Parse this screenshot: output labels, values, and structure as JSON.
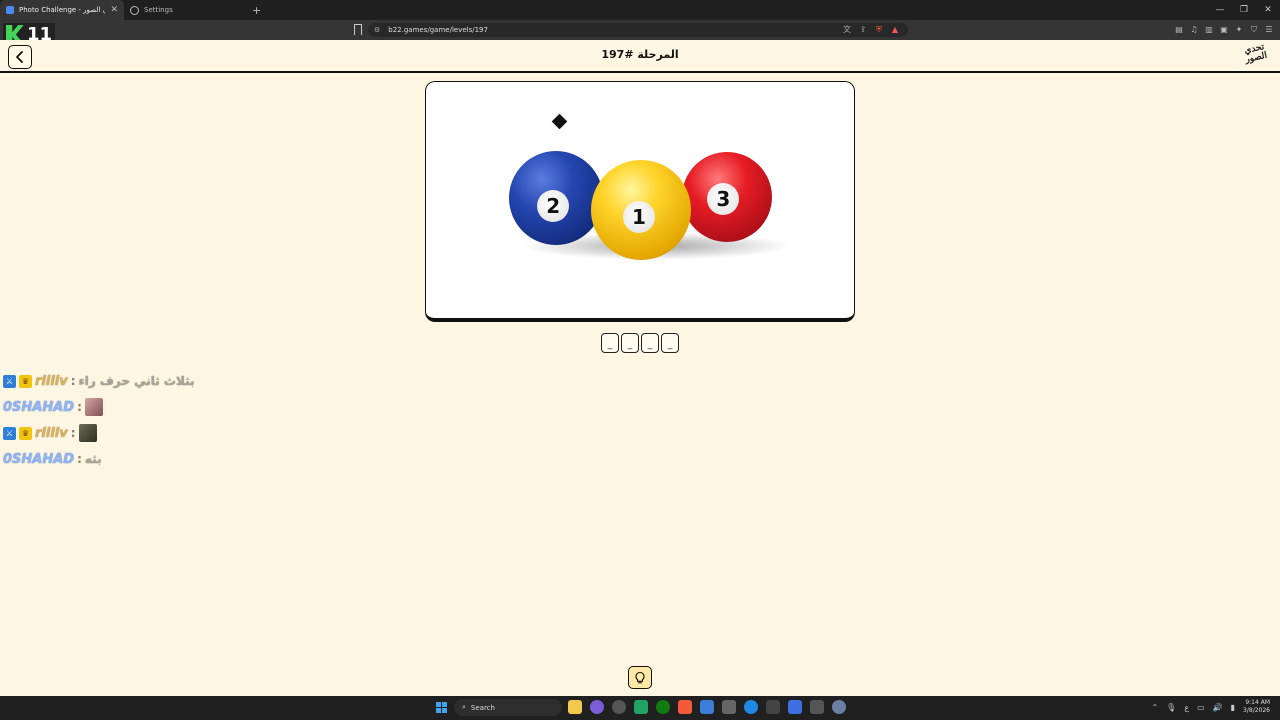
{
  "browser": {
    "tabs": [
      {
        "title": "Photo Challenge - تحدي الصور",
        "active": true
      },
      {
        "title": "Settings",
        "active": false
      }
    ],
    "url": "b22.games/game/levels/197"
  },
  "overlay": {
    "counter": "11"
  },
  "header": {
    "level_title": "المرحلة #197",
    "logo_text": "تحدي الصور"
  },
  "puzzle": {
    "balls": [
      {
        "number": "2",
        "color": "blue"
      },
      {
        "number": "1",
        "color": "yellow"
      },
      {
        "number": "3",
        "color": "red"
      }
    ],
    "slots": [
      "_",
      "_",
      "_",
      "_"
    ]
  },
  "chat": [
    {
      "user": "rllllv",
      "message": "بثلاث ثاني حرف راء",
      "badges": [
        "mod",
        "vip"
      ],
      "color": "gold"
    },
    {
      "user": "0SHAHAD",
      "message": "",
      "emote": "e1",
      "color": "blue"
    },
    {
      "user": "rllllv",
      "message": "",
      "emote": "e2",
      "badges": [
        "mod",
        "vip"
      ],
      "color": "gold"
    },
    {
      "user": "0SHAHAD",
      "message": "بثه",
      "color": "blue"
    }
  ],
  "taskbar": {
    "search_label": "Search",
    "time": "9:14 AM",
    "date": "3/8/2026",
    "lang": "ع"
  }
}
